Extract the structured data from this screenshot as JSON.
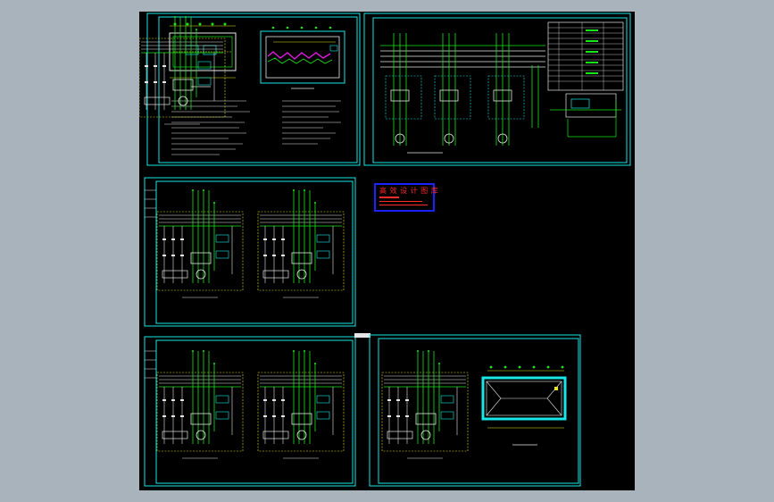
{
  "viewport": {
    "background": "#000000",
    "frame_color": "#19e6e6"
  },
  "stamp": {
    "title": "高 效 设 计 图 库",
    "border_color": "#1a22ff",
    "text_color": "#ff2a2a"
  },
  "colors": {
    "frame": "#19e6e6",
    "wire_green": "#19e619",
    "wire_white": "#e6e6e6",
    "wire_yellow": "#e6e619",
    "wire_cyan": "#19c8e6",
    "accent_magenta": "#e619e6",
    "accent_red": "#ff2a2a"
  }
}
